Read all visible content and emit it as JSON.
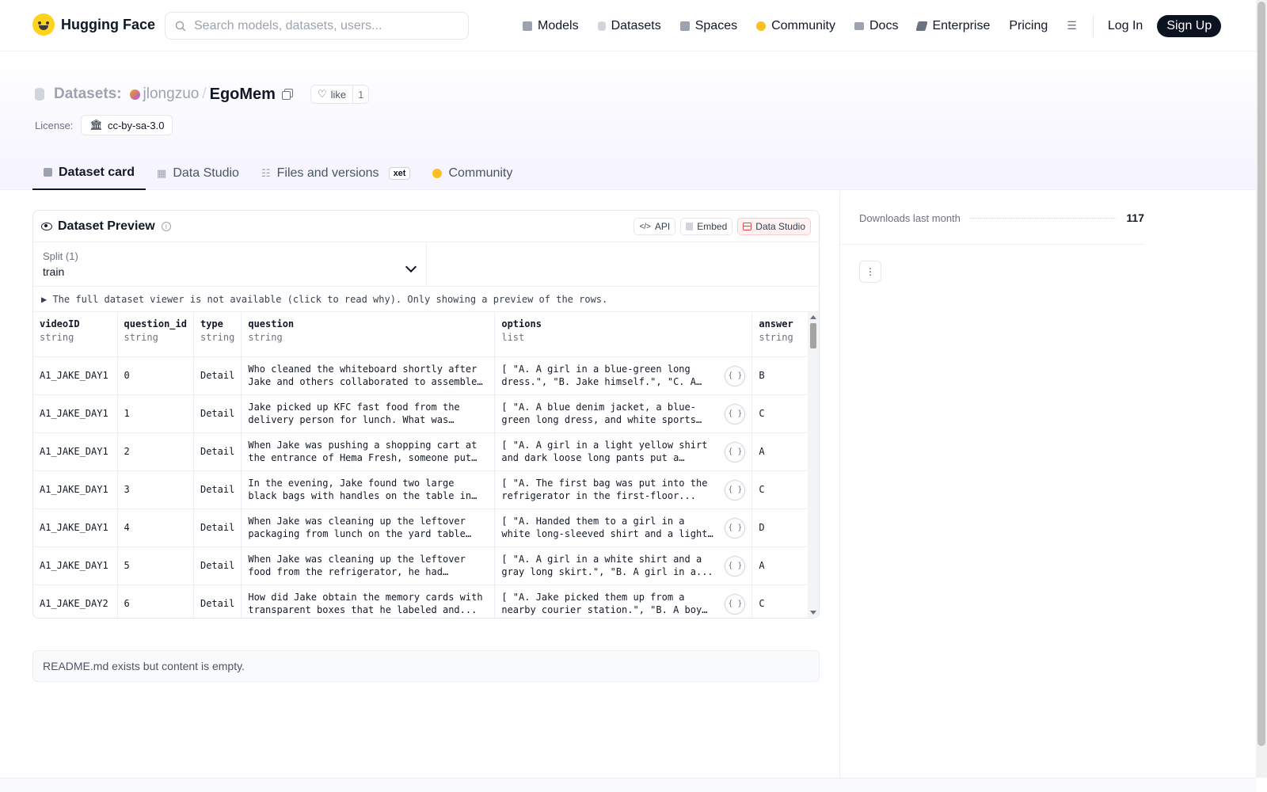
{
  "nav": {
    "brand": "Hugging Face",
    "search_placeholder": "Search models, datasets, users...",
    "links": [
      {
        "label": "Models",
        "icon": "models-icon",
        "color": "#9ca3af"
      },
      {
        "label": "Datasets",
        "icon": "datasets-icon",
        "color": "#d1d5db"
      },
      {
        "label": "Spaces",
        "icon": "spaces-icon",
        "color": "#9ca3af"
      },
      {
        "label": "Community",
        "icon": "community-icon",
        "color": "#fbbf24"
      },
      {
        "label": "Docs",
        "icon": "docs-icon",
        "color": "#9ca3af"
      },
      {
        "label": "Enterprise",
        "icon": "enterprise-icon",
        "color": "#6b7280"
      },
      {
        "label": "Pricing",
        "icon": "",
        "color": ""
      }
    ],
    "login": "Log In",
    "signup": "Sign Up"
  },
  "repo": {
    "type_label": "Datasets:",
    "owner": "jlongzuo",
    "name": "EgoMem",
    "like_label": "like",
    "like_count": "1",
    "license_label": "License:",
    "license": "cc-by-sa-3.0"
  },
  "tabs": [
    {
      "label": "Dataset card",
      "active": true
    },
    {
      "label": "Data Studio",
      "active": false
    },
    {
      "label": "Files and versions",
      "active": false,
      "badge": "xet"
    },
    {
      "label": "Community",
      "active": false
    }
  ],
  "preview": {
    "title": "Dataset Preview",
    "btn_api": "API",
    "btn_embed": "Embed",
    "btn_studio": "Data Studio",
    "split_label": "Split (1)",
    "split_value": "train",
    "notice": "▶ The full dataset viewer is not available (click to read why). Only showing a preview of the rows.",
    "columns": [
      {
        "name": "videoID",
        "type": "string"
      },
      {
        "name": "question_id",
        "type": "string"
      },
      {
        "name": "type",
        "type": "string"
      },
      {
        "name": "question",
        "type": "string"
      },
      {
        "name": "options",
        "type": "list"
      },
      {
        "name": "answer",
        "type": "string"
      }
    ],
    "rows": [
      [
        "A1_JAKE_DAY1",
        "0",
        "Detail",
        "Who cleaned the whiteboard shortly after Jake and others collaborated to assemble it...",
        "[ \"A. A girl in a blue-green long dress.\", \"B. Jake himself.\", \"C. A boy...",
        "B"
      ],
      [
        "A1_JAKE_DAY1",
        "1",
        "Detail",
        "Jake picked up KFC fast food from the delivery person for lunch. What was the...",
        "[ \"A. A blue denim jacket, a blue-green long dress, and white sports shoes.\",...",
        "C"
      ],
      [
        "A1_JAKE_DAY1",
        "2",
        "Detail",
        "When Jake was pushing a shopping cart at the entrance of Hema Fresh, someone put an item...",
        "[ \"A. A girl in a light yellow shirt and dark loose long pants put a bottle...",
        "A"
      ],
      [
        "A1_JAKE_DAY1",
        "3",
        "Detail",
        "In the evening, Jake found two large black bags with handles on the table in the first...",
        "[ \"A. The first bag was put into the refrigerator in the first-floor...",
        "C"
      ],
      [
        "A1_JAKE_DAY1",
        "4",
        "Detail",
        "When Jake was cleaning up the leftover packaging from lunch on the yard table in...",
        "[ \"A. Handed them to a girl in a white long-sleeved shirt and a light gray...",
        "D"
      ],
      [
        "A1_JAKE_DAY1",
        "5",
        "Detail",
        "When Jake was cleaning up the leftover food from the refrigerator, he had trouble...",
        "[ \"A. A girl in a white shirt and a gray long skirt.\", \"B. A girl in a...",
        "A"
      ],
      [
        "A1_JAKE_DAY2",
        "6",
        "Detail",
        "How did Jake obtain the memory cards with transparent boxes that he labeled and...",
        "[ \"A. Jake picked them up from a nearby courier station.\", \"B. A boy in a blue...",
        "C"
      ]
    ]
  },
  "readme_text": "README.md exists but content is empty.",
  "sidebar": {
    "downloads_label": "Downloads last month",
    "downloads_value": "117"
  }
}
